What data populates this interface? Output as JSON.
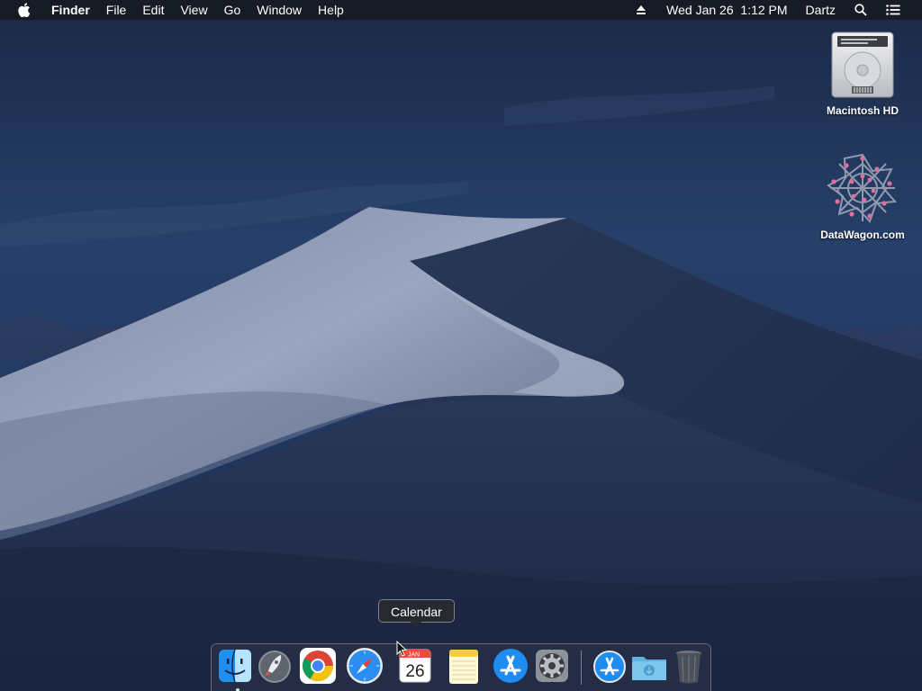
{
  "menubar": {
    "app_name": "Finder",
    "menus": [
      "File",
      "Edit",
      "View",
      "Go",
      "Window",
      "Help"
    ],
    "datetime": "Wed Jan 26  1:12 PM",
    "user": "Dartz"
  },
  "desktop_icons": [
    {
      "label": "Macintosh HD",
      "icon": "hard-drive-icon"
    },
    {
      "label": "DataWagon.com",
      "icon": "network-volume-icon"
    }
  ],
  "tooltip": {
    "text": "Calendar"
  },
  "dock": {
    "items": [
      {
        "name": "Finder",
        "icon": "finder-icon",
        "running": true
      },
      {
        "name": "Launchpad",
        "icon": "launchpad-icon",
        "running": false
      },
      {
        "name": "Google Chrome",
        "icon": "chrome-icon",
        "running": false
      },
      {
        "name": "Safari",
        "icon": "safari-icon",
        "running": false
      },
      {
        "name": "Calendar",
        "icon": "calendar-icon",
        "running": false,
        "month": "JAN",
        "day": "26"
      },
      {
        "name": "Notes",
        "icon": "notes-icon",
        "running": false
      },
      {
        "name": "App Store",
        "icon": "app-store-icon",
        "running": false
      },
      {
        "name": "System Preferences",
        "icon": "system-preferences-icon",
        "running": false
      },
      {
        "name": "Applications",
        "icon": "applications-stack-icon",
        "running": false
      },
      {
        "name": "Downloads",
        "icon": "downloads-folder-icon",
        "running": false
      },
      {
        "name": "Trash",
        "icon": "trash-icon",
        "running": false
      }
    ]
  },
  "colors": {
    "menubar_bg": "#161a24",
    "wallpaper_sky": "#22355a",
    "dune_light": "#8f9bb6",
    "dune_shadow": "#1e2a48"
  }
}
